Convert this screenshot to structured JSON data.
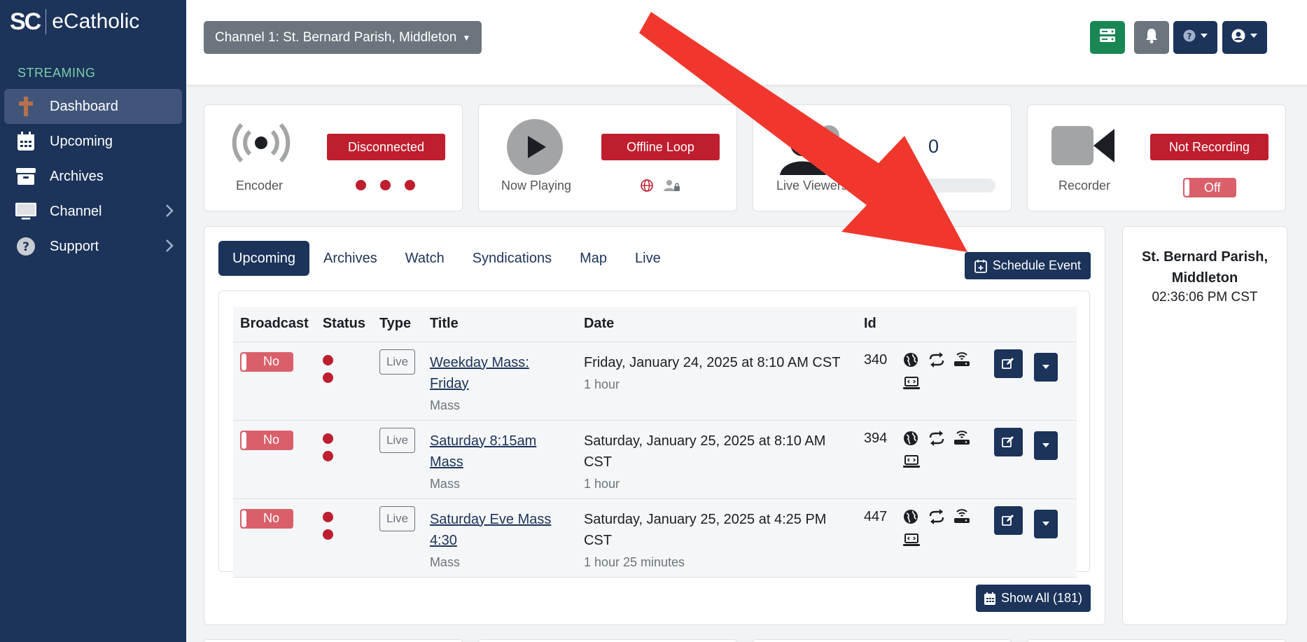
{
  "brand": {
    "mark": "SC",
    "name": "eCatholic"
  },
  "sidebar": {
    "section": "STREAMING",
    "items": [
      {
        "label": "Dashboard",
        "icon": "cross-icon"
      },
      {
        "label": "Upcoming",
        "icon": "calendar-icon"
      },
      {
        "label": "Archives",
        "icon": "archive-box-icon"
      },
      {
        "label": "Channel",
        "icon": "monitor-icon"
      },
      {
        "label": "Support",
        "icon": "question-icon"
      }
    ]
  },
  "topbar": {
    "channel": "Channel 1: St. Bernard Parish, Middleton"
  },
  "cards": {
    "encoder": {
      "label": "Encoder",
      "status": "Disconnected"
    },
    "now_playing": {
      "label": "Now Playing",
      "status": "Offline Loop"
    },
    "live_viewers": {
      "label": "Live Viewers",
      "count": "0",
      "progress": 0
    },
    "recorder": {
      "label": "Recorder",
      "status": "Not Recording",
      "toggle": "Off"
    }
  },
  "tabs": [
    "Upcoming",
    "Archives",
    "Watch",
    "Syndications",
    "Map",
    "Live"
  ],
  "schedule_button": "Schedule Event",
  "table": {
    "headers": [
      "Broadcast",
      "Status",
      "Type",
      "Title",
      "Date",
      "Id"
    ],
    "rows": [
      {
        "broadcast": "No",
        "type": "Live",
        "title": "Weekday Mass: Friday",
        "category": "Mass",
        "date": "Friday, January 24, 2025 at 8:10 AM CST",
        "duration": "1 hour",
        "id": "340"
      },
      {
        "broadcast": "No",
        "type": "Live",
        "title": "Saturday 8:15am Mass",
        "category": "Mass",
        "date": "Saturday, January 25, 2025 at 8:10 AM CST",
        "duration": "1 hour",
        "id": "394"
      },
      {
        "broadcast": "No",
        "type": "Live",
        "title": "Saturday Eve Mass 4:30",
        "category": "Mass",
        "date": "Saturday, January 25, 2025 at 4:25 PM CST",
        "duration": "1 hour 25 minutes",
        "id": "447"
      }
    ]
  },
  "show_all": "Show All (181)",
  "info": {
    "name": "St. Bernard Parish, Middleton",
    "time": "02:36:06 PM CST"
  },
  "colors": {
    "navy": "#1c335a",
    "red": "#bf1e2e",
    "green": "#198754",
    "gray": "#6c757d",
    "annotation_arrow": "#f0372d"
  }
}
